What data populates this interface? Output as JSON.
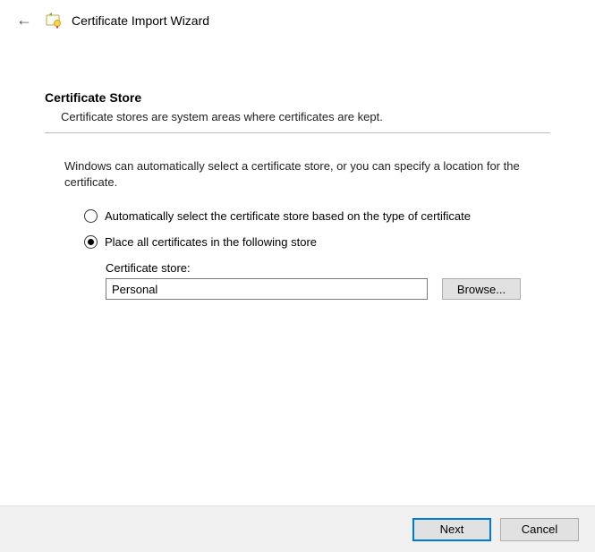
{
  "header": {
    "title": "Certificate Import Wizard"
  },
  "section": {
    "title": "Certificate Store",
    "desc": "Certificate stores are system areas where certificates are kept."
  },
  "explain": "Windows can automatically select a certificate store, or you can specify a location for the certificate.",
  "radios": {
    "auto": "Automatically select the certificate store based on the type of certificate",
    "place": "Place all certificates in the following store",
    "selected": "place"
  },
  "store": {
    "label": "Certificate store:",
    "value": "Personal",
    "browse": "Browse..."
  },
  "footer": {
    "next": "Next",
    "cancel": "Cancel"
  }
}
